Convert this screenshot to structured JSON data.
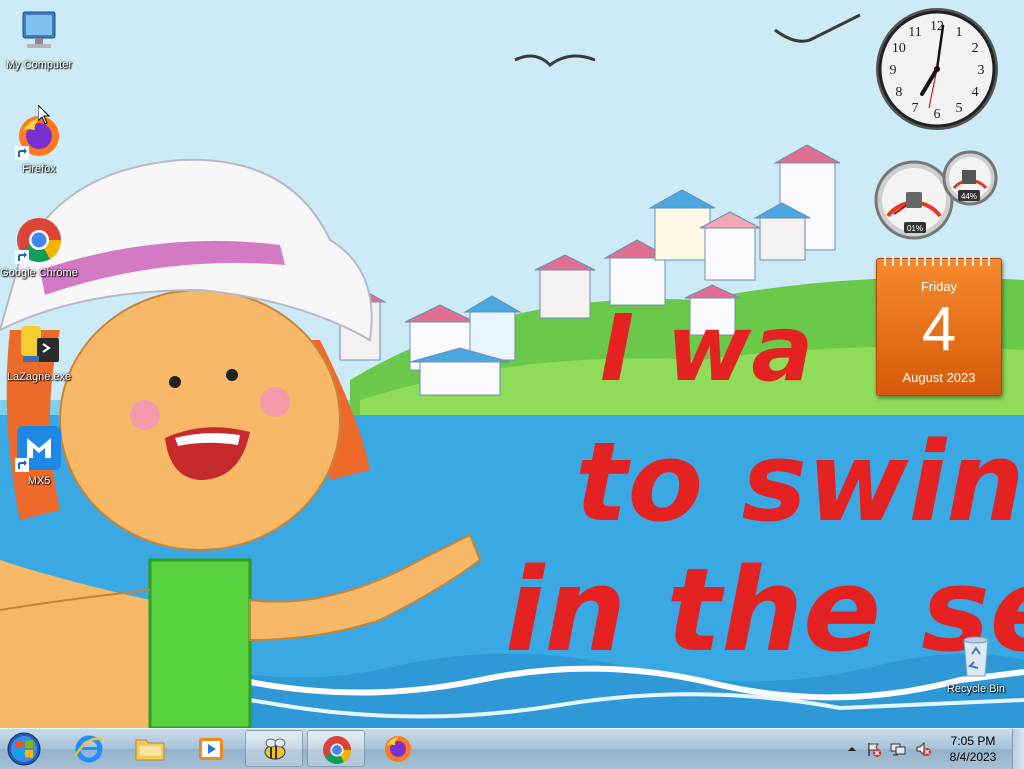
{
  "desktop": {
    "wallpaper_text": [
      "I wa",
      "to swin",
      "in the se"
    ],
    "icons": [
      {
        "label": "My Computer",
        "icon": "computer-icon"
      },
      {
        "label": "Firefox",
        "icon": "firefox-icon"
      },
      {
        "label": "Google Chrome",
        "icon": "chrome-icon"
      },
      {
        "label": "LaZagne.exe",
        "icon": "python-exe-icon"
      },
      {
        "label": "MX5",
        "icon": "maxthon-icon"
      },
      {
        "label": "Recycle Bin",
        "icon": "recycle-bin-icon"
      }
    ]
  },
  "gadgets": {
    "clock": {
      "time": "7:05",
      "numerals": [
        "12",
        "1",
        "2",
        "3",
        "4",
        "5",
        "6",
        "7",
        "8",
        "9",
        "10",
        "11"
      ]
    },
    "cpu_meter": {
      "cpu": "01%",
      "memory": "44%"
    },
    "calendar": {
      "weekday": "Friday",
      "day": "4",
      "month_year": "August 2023"
    }
  },
  "taskbar": {
    "start": "start-orb-icon",
    "pinned": [
      {
        "name": "internet-explorer",
        "icon": "ie-icon"
      },
      {
        "name": "windows-explorer",
        "icon": "folder-icon"
      },
      {
        "name": "media-player",
        "icon": "media-player-icon"
      },
      {
        "name": "bee-app",
        "icon": "bee-icon",
        "active": true
      },
      {
        "name": "chrome",
        "icon": "chrome-icon",
        "active": true
      },
      {
        "name": "firefox",
        "icon": "firefox-icon"
      }
    ],
    "tray": {
      "time": "7:05 PM",
      "date": "8/4/2023"
    }
  },
  "colors": {
    "calendar_orange": "#e86f18",
    "taskbar": "#a9c3d9",
    "wallpaper_text_red": "#e52222"
  }
}
